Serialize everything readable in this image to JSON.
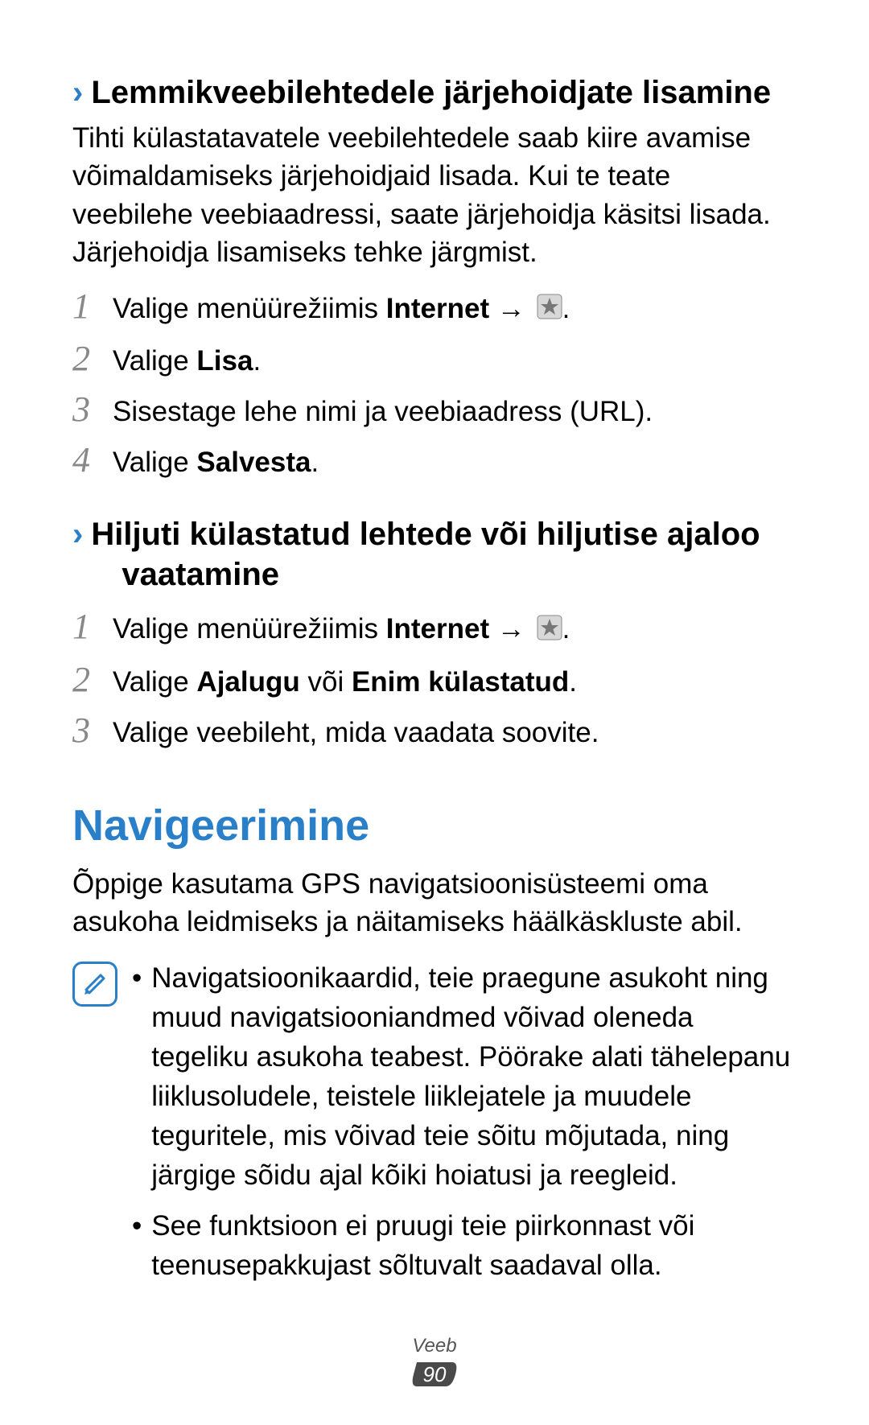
{
  "section1": {
    "heading": "Lemmikveebilehtedele järjehoidjate lisamine",
    "intro": "Tihti külastatavatele veebilehtedele saab kiire avamise võimaldamiseks järjehoidjaid lisada. Kui te teate veebilehe veebiaadressi, saate järjehoidja käsitsi lisada. Järjehoidja lisamiseks tehke järgmist.",
    "steps": {
      "s1_pre": "Valige menüürežiimis ",
      "s1_bold": "Internet",
      "s1_arrow": " → ",
      "s1_end": ".",
      "s2_pre": "Valige ",
      "s2_bold": "Lisa",
      "s2_end": ".",
      "s3": "Sisestage lehe nimi ja veebiaadress (URL).",
      "s4_pre": "Valige ",
      "s4_bold": "Salvesta",
      "s4_end": "."
    }
  },
  "section2": {
    "heading_line1": "Hiljuti külastatud lehtede või hiljutise ajaloo",
    "heading_line2": "vaatamine",
    "steps": {
      "s1_pre": "Valige menüürežiimis ",
      "s1_bold": "Internet",
      "s1_arrow": " → ",
      "s1_end": ".",
      "s2_pre": "Valige ",
      "s2_bold1": "Ajalugu",
      "s2_mid": " või ",
      "s2_bold2": "Enim külastatud",
      "s2_end": ".",
      "s3": "Valige veebileht, mida vaadata soovite."
    }
  },
  "main": {
    "heading": "Navigeerimine",
    "intro": "Õppige kasutama GPS navigatsioonisüsteemi oma asukoha leidmiseks ja näitamiseks häälkäskluste abil.",
    "bullets": {
      "b1": "Navigatsioonikaardid, teie praegune asukoht ning muud navigatsiooniandmed võivad oleneda tegeliku asukoha teabest. Pöörake alati tähelepanu liiklusoludele, teistele liiklejatele ja muudele teguritele, mis võivad teie sõitu mõjutada, ning järgige sõidu ajal kõiki hoiatusi ja reegleid.",
      "b2": "See funktsioon ei pruugi teie piirkonnast või teenusepakkujast sõltuvalt saadaval olla."
    }
  },
  "footer": {
    "label": "Veeb",
    "page": "90"
  },
  "nums": {
    "n1": "1",
    "n2": "2",
    "n3": "3",
    "n4": "4"
  }
}
